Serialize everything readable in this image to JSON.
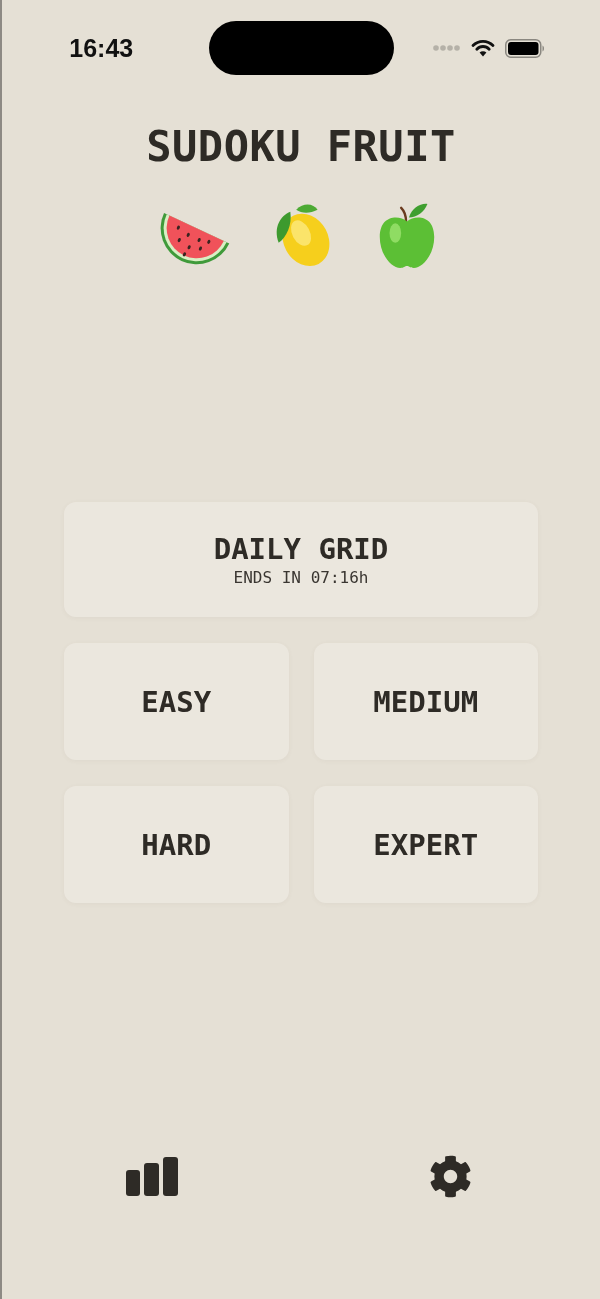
{
  "status_bar": {
    "time": "16:43"
  },
  "title": "SUDOKU FRUIT",
  "daily": {
    "title": "DAILY GRID",
    "countdown": "ENDS IN 07:16h"
  },
  "difficulties": [
    {
      "label": "EASY"
    },
    {
      "label": "MEDIUM"
    },
    {
      "label": "HARD"
    },
    {
      "label": "EXPERT"
    }
  ]
}
